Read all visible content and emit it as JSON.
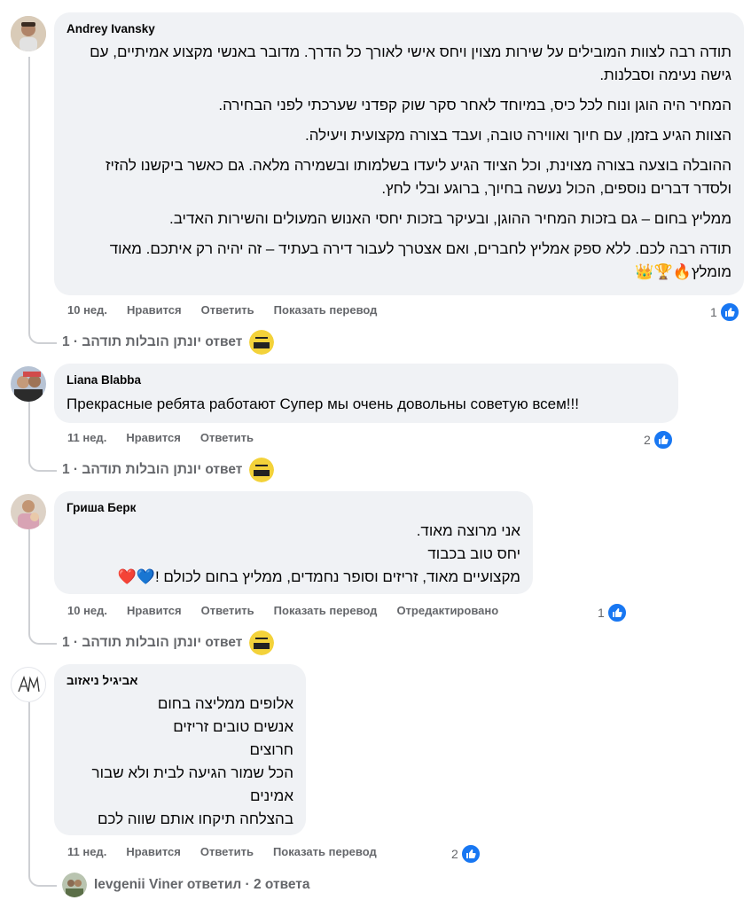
{
  "comments": [
    {
      "author": "Andrey Ivansky",
      "paragraphs": [
        "תודה רבה לצוות המובילים על שירות מצוין ויחס אישי לאורך כל הדרך. מדובר באנשי מקצוע אמיתיים, עם גישה נעימה וסבלנות.",
        "המחיר היה הוגן ונוח לכל כיס, במיוחד לאחר סקר שוק קפדני שערכתי לפני הבחירה.",
        "הצוות הגיע בזמן, עם חיוך ואווירה טובה, ועבד בצורה מקצועית ויעילה.",
        "ההובלה בוצעה בצורה מצוינת, וכל הציוד הגיע ליעדו בשלמותו ובשמירה מלאה. גם כאשר ביקשנו להזיז ולסדר דברים נוספים, הכול נעשה בחיוך, ברוגע ובלי לחץ.",
        "ממליץ בחום – גם בזכות המחיר ההוגן, ובעיקר בזכות יחסי האנוש המעולים והשירות האדיב.",
        "תודה רבה לכם. ללא ספק אמליץ לחברים, ואם אצטרך לעבור דירה בעתיד – זה יהיה רק איתכם. מאוד מומלץ🔥🏆👑"
      ],
      "time": "10 нед.",
      "like_label": "Нравится",
      "reply_label": "Ответить",
      "translate_label": "Показать перевод",
      "reaction_count": "1",
      "reply_summary": "יונתן הובלות תודהב · 1 ответ"
    },
    {
      "author": "Liana Blabba",
      "paragraphs": [
        "Прекрасные ребята работают Супер мы очень довольны советую всем!!!"
      ],
      "time": "11 нед.",
      "like_label": "Нравится",
      "reply_label": "Ответить",
      "reaction_count": "2",
      "reply_summary": "יונתן הובלות תודהב · 1 ответ"
    },
    {
      "author": "Гриша Берк",
      "paragraphs": [
        "אני מרוצה מאוד.",
        "יחס טוב בכבוד",
        "מקצועיים מאוד, זריזים וסופר נחמדים, ממליץ בחום לכולם !💙❤️"
      ],
      "time": "10 нед.",
      "like_label": "Нравится",
      "reply_label": "Ответить",
      "translate_label": "Показать перевод",
      "edited_label": "Отредактировано",
      "reaction_count": "1",
      "reply_summary": "יונתן הובלות תודהב · 1 ответ"
    },
    {
      "author": "אביגיל ניאזוב",
      "paragraphs": [
        "אלופים ממליצה בחום",
        "אנשים טובים זריזים",
        "חרוצים",
        "הכל שמור הגיעה לבית ולא שבור",
        "אמינים",
        "בהצלחה תיקחו אותם שווה לכם"
      ],
      "time": "11 нед.",
      "like_label": "Нравится",
      "reply_label": "Ответить",
      "translate_label": "Показать перевод",
      "reaction_count": "2",
      "reply_summary": "Ievgenii Viner ответил · 2 ответа"
    }
  ],
  "colors": {
    "like_blue": "#1877f2",
    "bubble_bg": "#f0f2f5",
    "meta_gray": "#65676b"
  },
  "icons": {
    "reaction": "thumbs-up-icon"
  }
}
